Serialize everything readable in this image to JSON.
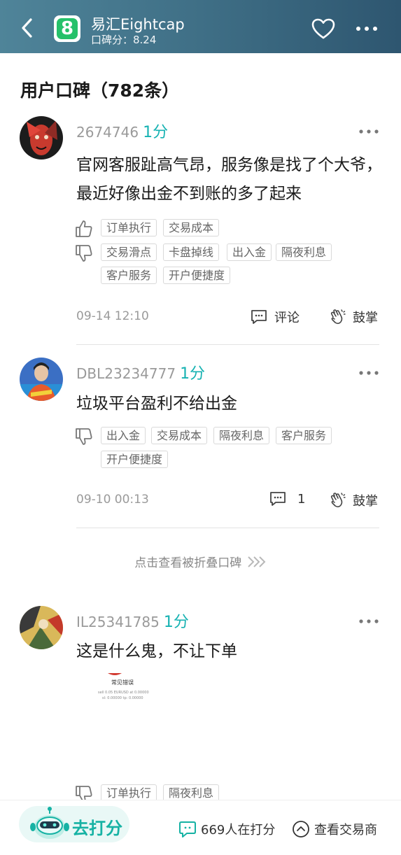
{
  "header": {
    "logo_text": "8",
    "title": "易汇Eightcap",
    "score_label": "口碑分：8.24",
    "accent": "#26c16a"
  },
  "section_title": "用户口碑（782条）",
  "reviews": [
    {
      "user": "2674746",
      "score": "1分",
      "content": "官网客服趾高气昂，服务像是找了个大爷，最近好像出金不到账的多了起来",
      "positive_tags": [
        "订单执行",
        "交易成本"
      ],
      "negative_tags": [
        "交易滑点",
        "卡盘掉线",
        "出入金",
        "隔夜利息",
        "客户服务",
        "开户便捷度"
      ],
      "time": "09-14 12:10",
      "comment_label": "评论",
      "clap_label": "鼓掌"
    },
    {
      "user": "DBL23234777",
      "score": "1分",
      "content": "垃圾平台盈利不给出金",
      "negative_tags": [
        "出入金",
        "交易成本",
        "隔夜利息",
        "客户服务",
        "开户便捷度"
      ],
      "time": "09-10 00:13",
      "comment_label": "1",
      "clap_label": "鼓掌"
    },
    {
      "user": "IL25341785",
      "score": "1分",
      "content": "这是什么鬼，不让下单",
      "image_text": {
        "title": "常见错误",
        "line1": "sell 0.05 EURUSD at 0.00000",
        "line2": "sl: 0.00000 tp: 0.00000"
      },
      "negative_tags": [
        "订单执行",
        "隔夜利息"
      ]
    }
  ],
  "fold_text": "点击查看被折叠口碑",
  "bottom": {
    "rate_label": "去打分",
    "rating_people": "669人在打分",
    "view_broker": "查看交易商"
  },
  "colors": {
    "score": "#16b2b2",
    "header_start": "#4f8499",
    "header_end": "#2e5670"
  },
  "icons": [
    "back-arrow-icon",
    "heart-icon",
    "more-icon",
    "thumbs-up-icon",
    "thumbs-down-icon",
    "comment-icon",
    "clap-icon",
    "chevron-double-right-icon",
    "robot-mascot-icon",
    "chat-bubble-icon",
    "chevron-up-circle-icon"
  ]
}
